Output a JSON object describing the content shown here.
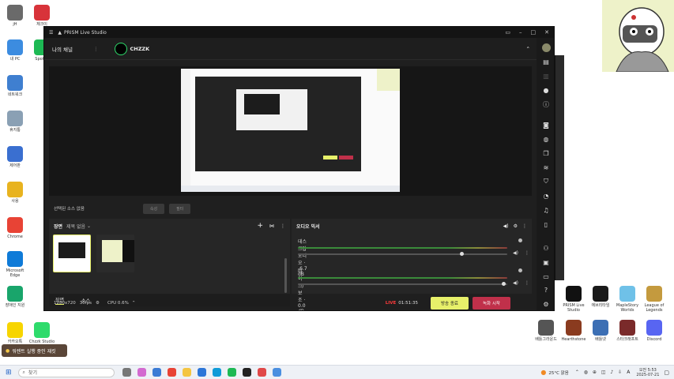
{
  "desktop_left_icons": [
    {
      "label": "jH",
      "color": "#6a6a6a"
    },
    {
      "label": "체크이",
      "color": "#d8333a"
    },
    {
      "label": "내 PC",
      "color": "#3c8ce0"
    },
    {
      "label": "Spotify",
      "color": "#1db954"
    },
    {
      "label": "네트워크",
      "color": "#3f7fd0"
    },
    {
      "label": "휴지통",
      "color": "#8aa0b4"
    },
    {
      "label": "제어판",
      "color": "#3a6fd0"
    },
    {
      "label": "사용",
      "color": "#e8b31f"
    },
    {
      "label": "Chrome",
      "color": "#e84335"
    },
    {
      "label": "Microsoft Edge",
      "color": "#0f7bd8"
    },
    {
      "label": "장애인 지원",
      "color": "#19a56b"
    },
    {
      "label": "카카오톡",
      "color": "#f7d500"
    },
    {
      "label": "Chzzk Studio",
      "color": "#2edb6b"
    }
  ],
  "desktop_right_icons": [
    {
      "label": "PRISM Live Studio",
      "color": "#111111"
    },
    {
      "label": "에브리타임",
      "color": "#1a1a1a"
    },
    {
      "label": "MapleStory Worlds",
      "color": "#6fc1e8"
    },
    {
      "label": "League of Legends",
      "color": "#c49a3e"
    },
    {
      "label": "배틀그라운드",
      "color": "#555555"
    },
    {
      "label": "Hearthstone",
      "color": "#8a3b1f"
    },
    {
      "label": "배틀넷",
      "color": "#3c6fb4"
    },
    {
      "label": "스타크래프트",
      "color": "#7a2a2a"
    },
    {
      "label": "Discord",
      "color": "#5865f2"
    }
  ],
  "notify_label": "워렌트 실행 중인 재킷",
  "prism": {
    "app_title": "PRISM Live Studio",
    "channel_label": "나의 채널",
    "platform": "CHZZK",
    "selected_source_label": "선택된 소스 없음",
    "btn_properties": "속성",
    "btn_filters": "필터",
    "scenes_title": "장면",
    "scenes_dropdown": "제목 없음",
    "tab_scenes": "장면",
    "tab_sources": "소스",
    "mixer_title": "오디오 믹서",
    "mixer_rows": [
      {
        "name": "데스크탑 오디오",
        "level": "-6.7 dB",
        "volume": 0.78
      },
      {
        "name": "마이크/보조",
        "level": "0.0 dB",
        "volume": 0.98
      }
    ],
    "resolution": "1280x720",
    "fps": "30fps",
    "cpu": "CPU 0.6%",
    "live_badge": "LIVE",
    "live_time": "01:51:35",
    "end_broadcast": "방송 종료",
    "start_recording": "녹화 시작"
  },
  "taskbar": {
    "search_placeholder": "찾기",
    "weather": "25°C 맑음",
    "lang": "A",
    "time": "오전 5:53",
    "date": "2025-07-21"
  },
  "colors": {
    "accent_green": "#2edb6b",
    "end_button": "#e7f06a",
    "record_button": "#c0304a",
    "live_red": "#ff3b3b"
  }
}
